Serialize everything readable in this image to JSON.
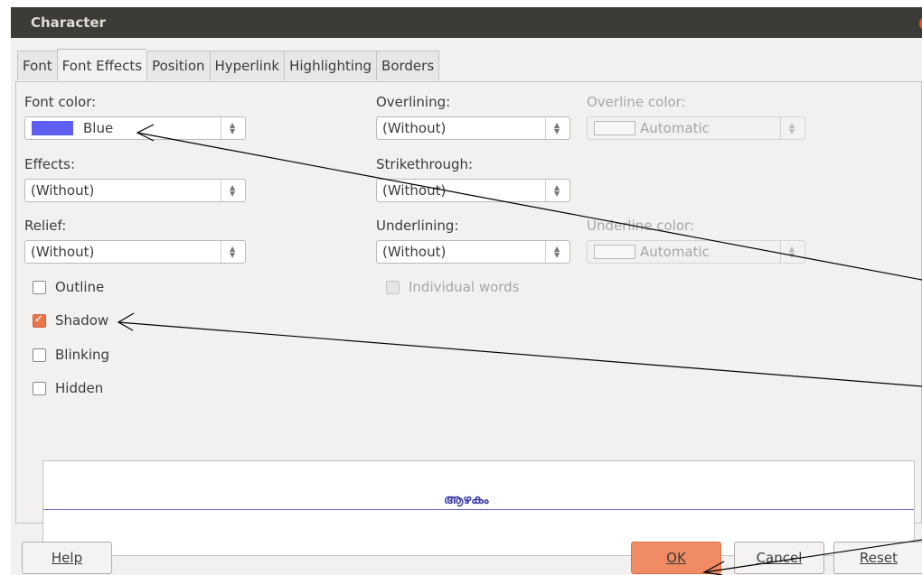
{
  "window": {
    "title": "Character"
  },
  "tabs": [
    "Font",
    "Font Effects",
    "Position",
    "Hyperlink",
    "Highlighting",
    "Borders"
  ],
  "left": {
    "font_color_label": "Font color:",
    "font_color_value": "Blue",
    "font_color_hex": "#5e5ef0",
    "effects_label": "Effects:",
    "effects_value": "(Without)",
    "relief_label": "Relief:",
    "relief_value": "(Without)"
  },
  "middle": {
    "overlining_label": "Overlining:",
    "overlining_value": "(Without)",
    "strikethrough_label": "Strikethrough:",
    "strikethrough_value": "(Without)",
    "underlining_label": "Underlining:",
    "underlining_value": "(Without)",
    "individual_words_label": "Individual words"
  },
  "right": {
    "overline_color_label": "Overline color:",
    "overline_color_value": "Automatic",
    "underline_color_label": "Underline color:",
    "underline_color_value": "Automatic"
  },
  "checkboxes": {
    "outline": {
      "label": "Outline",
      "checked": false
    },
    "shadow": {
      "label": "Shadow",
      "checked": true
    },
    "blinking": {
      "label": "Blinking",
      "checked": false
    },
    "hidden": {
      "label": "Hidden",
      "checked": false
    }
  },
  "preview": {
    "text": "ആഴകം"
  },
  "buttons": {
    "help": "Help",
    "ok": "OK",
    "cancel": "Cancel",
    "reset": "Reset"
  },
  "colors": {
    "titlebar": "#3c3b37",
    "ok_button": "#f08b64",
    "checkbox_checked": "#e9754b"
  }
}
